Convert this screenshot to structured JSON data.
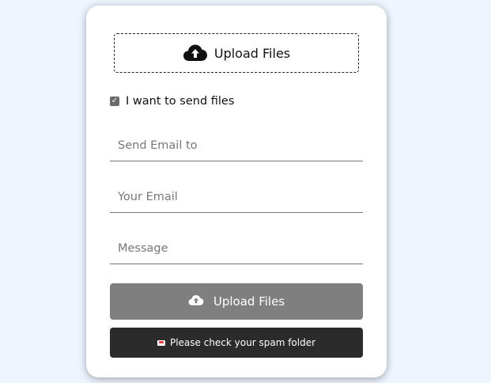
{
  "dropzone": {
    "label": "Upload Files",
    "icon": "cloud-upload-icon"
  },
  "send_files_checkbox": {
    "label": "I want to send files",
    "checked": true
  },
  "form": {
    "send_to_placeholder": "Send Email to",
    "your_email_placeholder": "Your Email",
    "message_placeholder": "Message"
  },
  "upload_button": {
    "label": "Upload Files",
    "icon": "cloud-upload-icon"
  },
  "notice": {
    "text": "Please check your spam folder",
    "icon": "mail-icon"
  },
  "colors": {
    "background": "#eef5ff",
    "button_gray": "#7f7f7f",
    "notice_dark": "#2b2b2b"
  }
}
